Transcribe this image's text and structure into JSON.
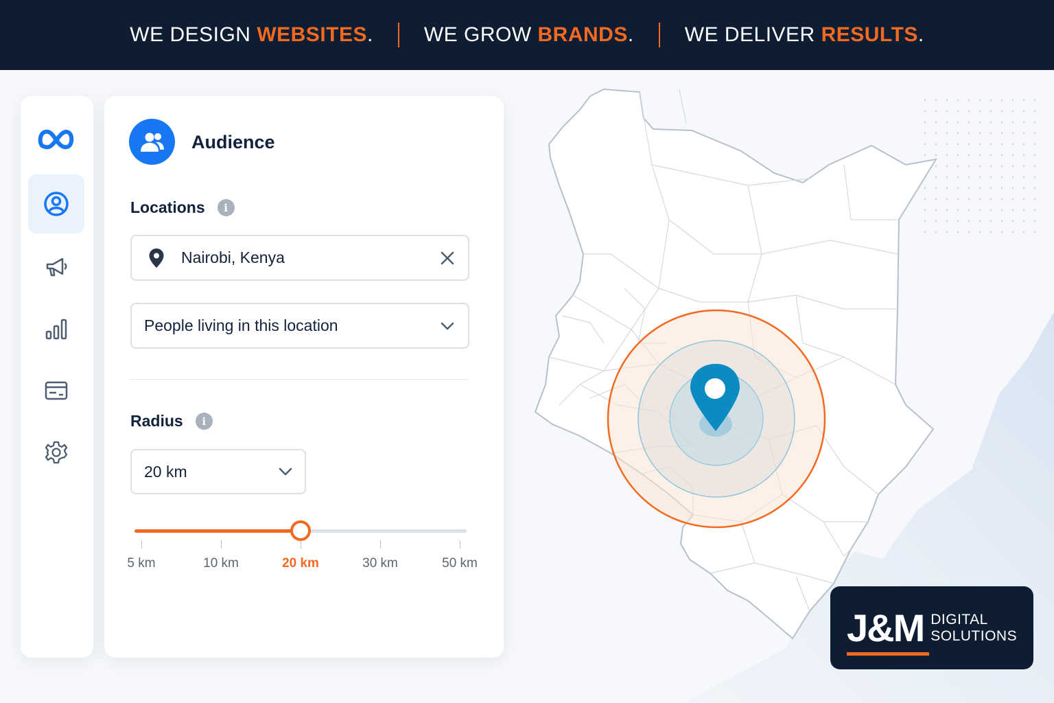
{
  "banner": {
    "parts": [
      {
        "prefix": "WE DESIGN ",
        "accent": "WEBSITES",
        "dot": "."
      },
      {
        "prefix": "WE GROW ",
        "accent": "BRANDS",
        "dot": "."
      },
      {
        "prefix": "WE DELIVER ",
        "accent": "RESULTS",
        "dot": "."
      }
    ]
  },
  "sidebar": {
    "items": [
      {
        "icon": "meta-logo-icon"
      },
      {
        "icon": "audience-icon",
        "active": true
      },
      {
        "icon": "megaphone-icon"
      },
      {
        "icon": "bar-chart-icon"
      },
      {
        "icon": "billing-icon"
      },
      {
        "icon": "settings-icon"
      }
    ]
  },
  "panel": {
    "title": "Audience",
    "locations_label": "Locations",
    "location_value": "Nairobi, Kenya",
    "location_type": "People living in this location",
    "radius_label": "Radius",
    "radius_value": "20 km",
    "info_glyph": "i"
  },
  "slider": {
    "value_fraction": 0.5,
    "ticks": [
      "5 km",
      "10 km",
      "20 km",
      "30 km",
      "50 km"
    ],
    "selected": "20 km"
  },
  "map": {
    "country": "Kenya",
    "pin_location": "Nairobi"
  },
  "logo": {
    "mark": "J&M",
    "line1": "DIGITAL",
    "line2": "SOLUTIONS"
  },
  "colors": {
    "navy": "#0f1d33",
    "orange": "#f26a21",
    "meta_blue": "#1877f2",
    "pin_blue": "#0b8bc2"
  }
}
